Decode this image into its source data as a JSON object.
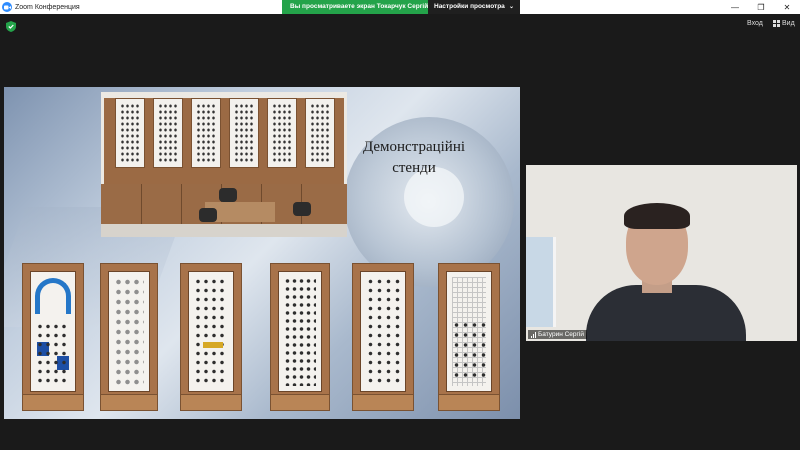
{
  "titlebar": {
    "app_title": "Zoom Конференция",
    "share_text": "Вы просматриваете экран Токарчук Сергій",
    "view_options_label": "Настройки просмотра",
    "view_options_chevron": "⌄",
    "controls": {
      "minimize": "—",
      "restore": "❐",
      "close": "✕"
    }
  },
  "topbar": {
    "enter_label": "Вход",
    "view_label": "Вид"
  },
  "slide": {
    "title_line1": "Демонстраційні",
    "title_line2": "стенди"
  },
  "video": {
    "participant_name": "Батурин Сергій"
  },
  "colors": {
    "share_green": "#24a34a",
    "zoom_blue": "#2d8cff",
    "background": "#1a1a1a"
  },
  "icons": [
    "zoom-logo-icon",
    "shield-icon",
    "grid-icon",
    "mic-level-icon"
  ]
}
